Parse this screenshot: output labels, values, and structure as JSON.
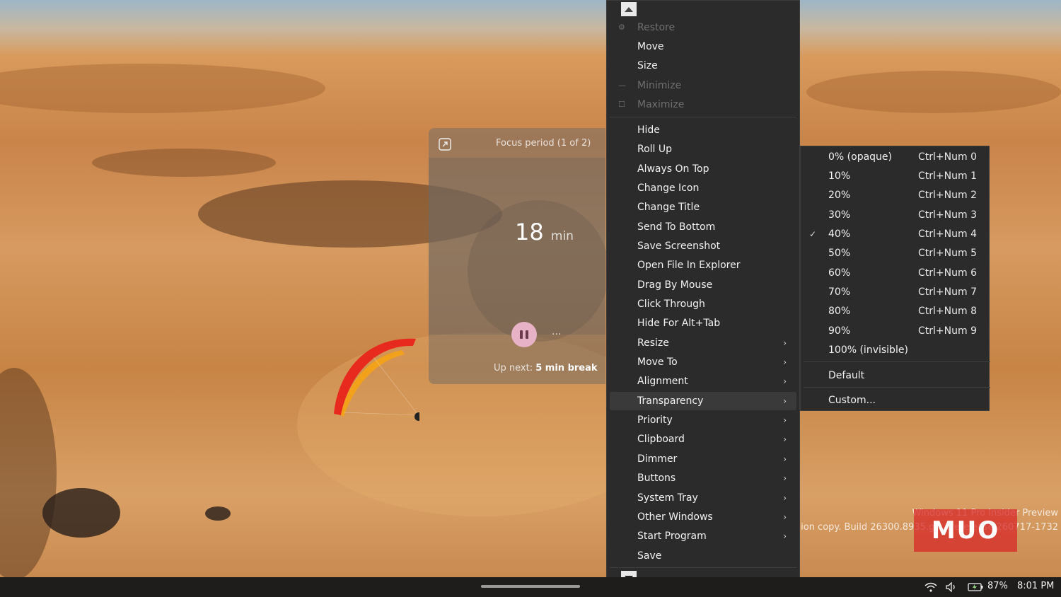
{
  "focus_widget": {
    "title": "Focus period (1 of 2)",
    "minutes_value": "18",
    "minutes_unit": "min",
    "more_label": "...",
    "up_next_prefix": "Up next:",
    "up_next_value": "5 min break"
  },
  "context_menu": {
    "items": [
      {
        "label": "Restore",
        "disabled": true
      },
      {
        "label": "Move"
      },
      {
        "label": "Size"
      },
      {
        "label": "Minimize",
        "disabled": true
      },
      {
        "label": "Maximize",
        "disabled": true
      },
      {
        "label": "Hide"
      },
      {
        "label": "Roll Up"
      },
      {
        "label": "Always On Top"
      },
      {
        "label": "Change Icon"
      },
      {
        "label": "Change Title"
      },
      {
        "label": "Send To Bottom"
      },
      {
        "label": "Save Screenshot"
      },
      {
        "label": "Open File In Explorer"
      },
      {
        "label": "Drag By Mouse"
      },
      {
        "label": "Click Through"
      },
      {
        "label": "Hide For Alt+Tab"
      },
      {
        "label": "Resize",
        "submenu": true
      },
      {
        "label": "Move To",
        "submenu": true
      },
      {
        "label": "Alignment",
        "submenu": true
      },
      {
        "label": "Transparency",
        "submenu": true
      },
      {
        "label": "Priority",
        "submenu": true
      },
      {
        "label": "Clipboard",
        "submenu": true
      },
      {
        "label": "Dimmer",
        "submenu": true
      },
      {
        "label": "Buttons",
        "submenu": true
      },
      {
        "label": "System Tray",
        "submenu": true
      },
      {
        "label": "Other Windows",
        "submenu": true
      },
      {
        "label": "Start Program",
        "submenu": true
      },
      {
        "label": "Save"
      }
    ],
    "arrow_glyph": "›"
  },
  "transparency_submenu": {
    "items": [
      {
        "label": "0% (opaque)",
        "shortcut": "Ctrl+Num 0"
      },
      {
        "label": "10%",
        "shortcut": "Ctrl+Num 1"
      },
      {
        "label": "20%",
        "shortcut": "Ctrl+Num 2"
      },
      {
        "label": "30%",
        "shortcut": "Ctrl+Num 3"
      },
      {
        "label": "40%",
        "shortcut": "Ctrl+Num 4",
        "checked": true
      },
      {
        "label": "50%",
        "shortcut": "Ctrl+Num 5"
      },
      {
        "label": "60%",
        "shortcut": "Ctrl+Num 6"
      },
      {
        "label": "70%",
        "shortcut": "Ctrl+Num 7"
      },
      {
        "label": "80%",
        "shortcut": "Ctrl+Num 8"
      },
      {
        "label": "90%",
        "shortcut": "Ctrl+Num 9"
      },
      {
        "label": "100% (invisible)"
      },
      {
        "label": "Default"
      },
      {
        "label": "Custom..."
      }
    ],
    "check_glyph": "✓"
  },
  "watermark": {
    "line1": "Windows 11 Pro Insider Preview",
    "line2": "ion copy. Build 26300.8935.ge_prerelease.260717-1732",
    "logo": "MUO"
  },
  "taskbar": {
    "battery": "87%",
    "time": "8:01 PM"
  },
  "colors": {
    "menu_bg": "#2b2b2b",
    "pause_button": "#e8b2c6",
    "taskbar_bg": "#1f1d1c"
  }
}
